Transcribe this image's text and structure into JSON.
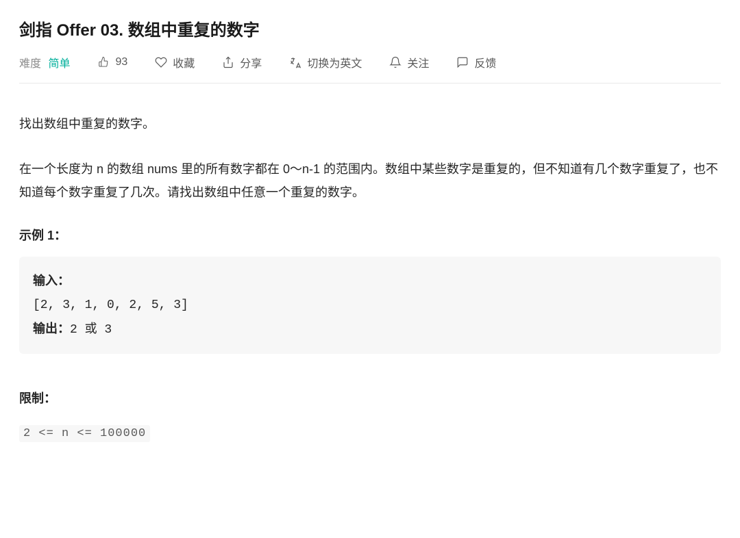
{
  "title": "剑指 Offer 03. 数组中重复的数字",
  "meta": {
    "difficulty_label": "难度",
    "difficulty_value": "简单",
    "likes": "93",
    "favorite": "收藏",
    "share": "分享",
    "switch_lang": "切换为英文",
    "follow": "关注",
    "feedback": "反馈"
  },
  "content": {
    "intro": "找出数组中重复的数字。",
    "description": "在一个长度为 n 的数组 nums 里的所有数字都在 0～n-1 的范围内。数组中某些数字是重复的，但不知道有几个数字重复了，也不知道每个数字重复了几次。请找出数组中任意一个重复的数字。",
    "example_label": "示例 1：",
    "example": {
      "input_label": "输入：",
      "input_value": "[2, 3, 1, 0, 2, 5, 3]",
      "output_label": "输出：",
      "output_value": "2 或 3"
    },
    "limit_label": "限制：",
    "limit_value": "2 <= n <= 100000"
  }
}
